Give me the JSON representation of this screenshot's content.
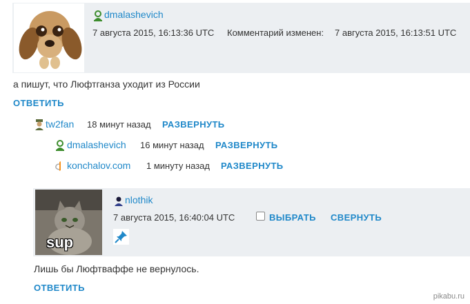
{
  "post": {
    "author": "dmalashevich",
    "created": "7 августа 2015, 16:13:36 UTC",
    "edited_label": "Комментарий изменен:",
    "edited": "7 августа 2015, 16:13:51 UTC",
    "text": "а пишут, что Люфтганза уходит из России",
    "reply_label": "ОТВЕТИТЬ",
    "avatar_icon": "dog-avatar"
  },
  "collapsed": [
    {
      "user": "tw2fan",
      "time": "18 минут назад",
      "action": "РАЗВЕРНУТЬ",
      "icon": "user-icon"
    },
    {
      "user": "dmalashevich",
      "time": "16 минут назад",
      "action": "РАЗВЕРНУТЬ",
      "icon": "user-icon"
    },
    {
      "user": "konchalov.com",
      "time": "1 минуту назад",
      "action": "РАЗВЕРНУТЬ",
      "icon": "openid-icon"
    }
  ],
  "reply": {
    "author": "nlothik",
    "created": "7 августа 2015, 16:40:04 UTC",
    "select_label": "ВЫБРАТЬ",
    "collapse_label": "СВЕРНУТЬ",
    "text": "Лишь бы Люфтваффе не вернулось.",
    "reply_label": "ОТВЕТИТЬ",
    "avatar_caption": "sup",
    "pin_icon": "pin-icon"
  },
  "watermark": "pikabu.ru",
  "colors": {
    "link": "#1f88c9",
    "panel": "#eceff2",
    "text": "#333333"
  }
}
